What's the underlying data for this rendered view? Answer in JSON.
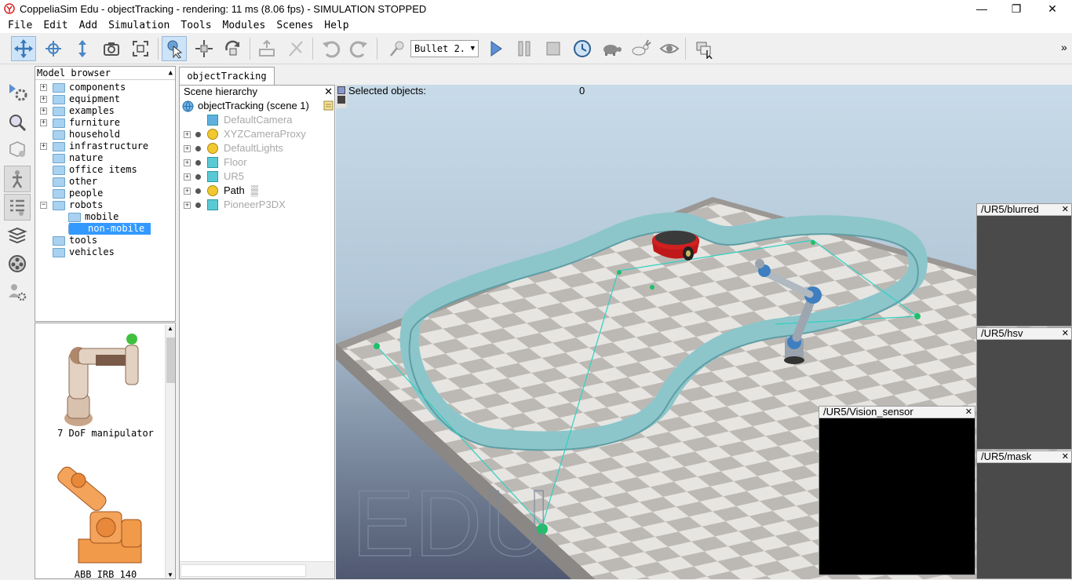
{
  "window": {
    "title": "CoppeliaSim Edu - objectTracking - rendering: 11 ms (8.06 fps) - SIMULATION STOPPED",
    "minimize": "—",
    "maximize": "❐",
    "close": "✕"
  },
  "menu": [
    "File",
    "Edit",
    "Add",
    "Simulation",
    "Tools",
    "Modules",
    "Scenes",
    "Help"
  ],
  "toolbar": {
    "engine_value": "Bullet 2.",
    "overflow": "»"
  },
  "model_browser": {
    "header": "Model browser",
    "items": [
      {
        "label": "components",
        "expandable": true
      },
      {
        "label": "equipment",
        "expandable": true
      },
      {
        "label": "examples",
        "expandable": true
      },
      {
        "label": "furniture",
        "expandable": true
      },
      {
        "label": "household",
        "expandable": false
      },
      {
        "label": "infrastructure",
        "expandable": true
      },
      {
        "label": "nature",
        "expandable": false
      },
      {
        "label": "office items",
        "expandable": false
      },
      {
        "label": "other",
        "expandable": false
      },
      {
        "label": "people",
        "expandable": false
      },
      {
        "label": "robots",
        "expandable": true
      },
      {
        "label": "mobile",
        "expandable": false
      },
      {
        "label": "non-mobile",
        "expandable": false
      },
      {
        "label": "tools",
        "expandable": false
      },
      {
        "label": "vehicles",
        "expandable": false
      }
    ],
    "thumbnails": [
      "7 DoF manipulator",
      "ABB IRB 140"
    ]
  },
  "scene_tab": "objectTracking",
  "hierarchy": {
    "header": "Scene hierarchy",
    "root": "objectTracking (scene 1)",
    "items": [
      "DefaultCamera",
      "XYZCameraProxy",
      "DefaultLights",
      "Floor",
      "UR5",
      "Path",
      "PioneerP3DX"
    ]
  },
  "viewport": {
    "selected_label": "Selected objects:",
    "selected_count": "0",
    "watermark": "EDU"
  },
  "sensor_windows": [
    "/UR5/blurred",
    "/UR5/hsv",
    "/UR5/mask",
    "/UR5/Vision_sensor"
  ],
  "colors": {
    "selection": "#3399ff",
    "path_wall": "#8fc7cc",
    "floor_light": "#e8e6e2",
    "floor_dark": "#b9b6b2"
  }
}
